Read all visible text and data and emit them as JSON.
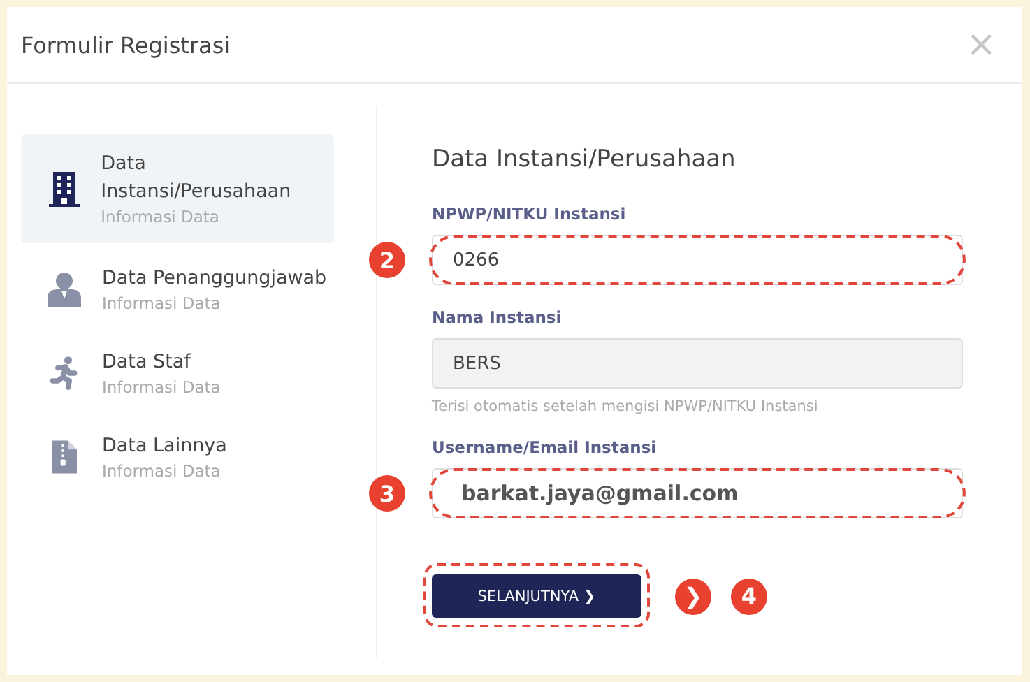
{
  "window": {
    "title": "Formulir Registrasi",
    "close": "×"
  },
  "sidebar": {
    "items": [
      {
        "title": "Data Instansi/Perusahaan",
        "subtitle": "Informasi Data",
        "kind": "building",
        "selected": true
      },
      {
        "title": "Data Penanggungjawab",
        "subtitle": "Informasi Data",
        "kind": "person",
        "selected": false
      },
      {
        "title": "Data Staf",
        "subtitle": "Informasi Data",
        "kind": "runner",
        "selected": false
      },
      {
        "title": "Data Lainnya",
        "subtitle": "Informasi Data",
        "kind": "file",
        "selected": false
      }
    ]
  },
  "form": {
    "title": "Data Instansi/Perusahaan",
    "fields": [
      {
        "label": "NPWP/NITKU Instansi",
        "value": "0266",
        "disabled": false,
        "bold": false,
        "highlighted": true,
        "marker": "2"
      },
      {
        "label": "Nama Instansi",
        "value": "BERS",
        "hint": "Terisi otomatis setelah mengisi NPWP/NITKU Instansi",
        "disabled": true,
        "bold": false,
        "highlighted": false
      },
      {
        "label": "Username/Email Instansi",
        "value": "barkat.jaya@gmail.com",
        "disabled": false,
        "bold": true,
        "highlighted": true,
        "marker": "3"
      }
    ],
    "button": {
      "label": "SELANJUTNYA",
      "icon": "❯",
      "highlighted": true,
      "arrow_marker": "❯",
      "marker": "4"
    }
  }
}
